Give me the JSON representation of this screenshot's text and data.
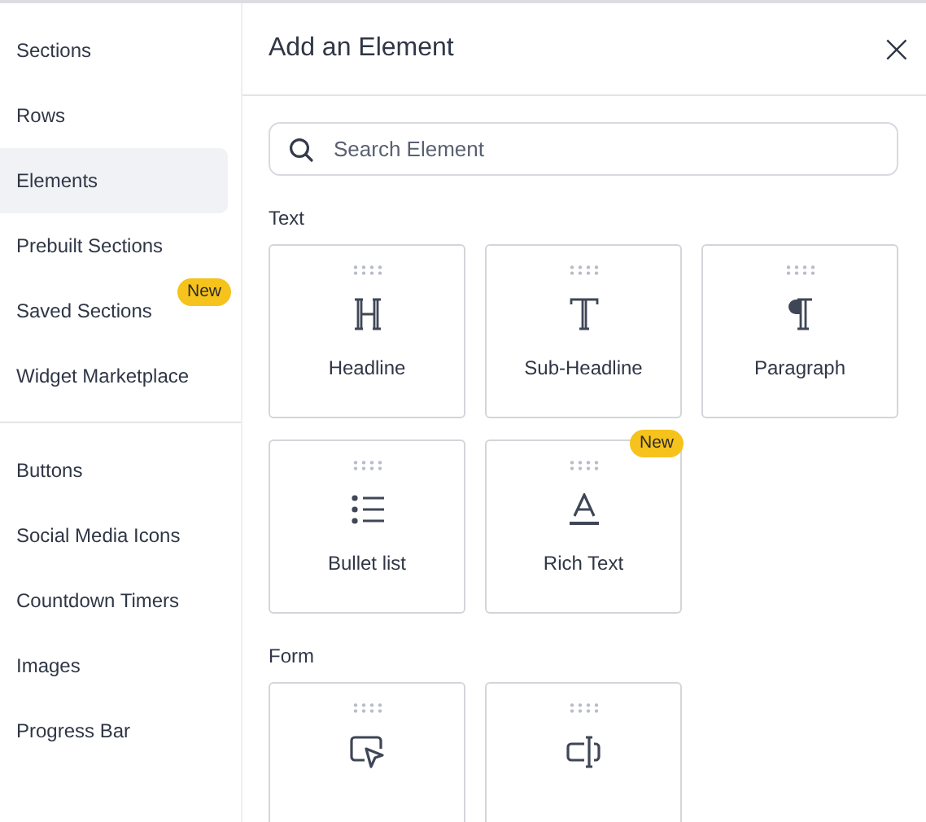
{
  "sidebar": {
    "groups": [
      {
        "items": [
          {
            "label": "Sections",
            "selected": false
          },
          {
            "label": "Rows",
            "selected": false
          },
          {
            "label": "Elements",
            "selected": true
          },
          {
            "label": "Prebuilt Sections",
            "selected": false
          },
          {
            "label": "Saved Sections",
            "selected": false,
            "badge": "New"
          },
          {
            "label": "Widget Marketplace",
            "selected": false
          }
        ]
      },
      {
        "items": [
          {
            "label": "Buttons",
            "selected": false
          },
          {
            "label": "Social Media Icons",
            "selected": false
          },
          {
            "label": "Countdown Timers",
            "selected": false
          },
          {
            "label": "Images",
            "selected": false
          },
          {
            "label": "Progress Bar",
            "selected": false
          }
        ]
      }
    ]
  },
  "panel": {
    "title": "Add an Element",
    "close": "×",
    "search": {
      "placeholder": "Search Element"
    },
    "categories": [
      {
        "title": "Text",
        "elements": [
          {
            "kind": "headline",
            "label": "Headline"
          },
          {
            "kind": "subheadline",
            "label": "Sub-Headline"
          },
          {
            "kind": "paragraph",
            "label": "Paragraph"
          },
          {
            "kind": "bullets",
            "label": "Bullet list"
          },
          {
            "kind": "richtext",
            "label": "Rich Text",
            "badge": "New"
          }
        ]
      },
      {
        "title": "Form",
        "elements": [
          {
            "kind": "pointer"
          },
          {
            "kind": "input"
          }
        ]
      }
    ]
  }
}
